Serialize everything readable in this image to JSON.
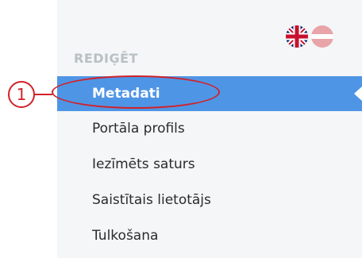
{
  "language_flags": [
    {
      "icon": "uk-flag-icon",
      "label": "English"
    },
    {
      "icon": "latvia-flag-icon",
      "label": "Latvian"
    }
  ],
  "sidebar": {
    "section_label": "REDIĢĒT",
    "items": [
      {
        "label": "Metadati",
        "active": true
      },
      {
        "label": "Portāla profils",
        "active": false
      },
      {
        "label": "Iezīmēts saturs",
        "active": false
      },
      {
        "label": "Saistītais lietotājs",
        "active": false
      },
      {
        "label": "Tulkošana",
        "active": false
      }
    ]
  },
  "annotation": {
    "number": "1",
    "color": "#d12229"
  },
  "colors": {
    "active_item_bg": "#4f95e6",
    "panel_bg": "#f4f6f7",
    "section_label": "#b9c0c4"
  }
}
